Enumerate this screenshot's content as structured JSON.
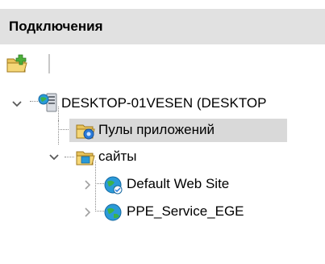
{
  "panel": {
    "title": "Подключения"
  },
  "toolbar": {
    "items": [
      {
        "icon": "new-connection-folder-icon",
        "label": ""
      }
    ]
  },
  "tree": {
    "server": {
      "label": "DESKTOP-01VESEN (DESKTOP",
      "expanded": true,
      "icon": "server-icon"
    },
    "app_pools": {
      "label": "Пулы приложений",
      "selected": true,
      "icon": "app-pools-icon"
    },
    "sites": {
      "label": "сайты",
      "expanded": true,
      "icon": "sites-folder-icon"
    },
    "site_items": [
      {
        "label": "Default Web Site",
        "expanded": false,
        "icon": "website-globe-icon"
      },
      {
        "label": "PPE_Service_EGE",
        "expanded": false,
        "icon": "website-globe-icon"
      }
    ]
  },
  "colors": {
    "header_bg": "#e1e1e1",
    "selected_bg": "#d9d9d9",
    "chevron": "#5a5a5a",
    "chevron_collapsed": "#a0a0a0"
  }
}
